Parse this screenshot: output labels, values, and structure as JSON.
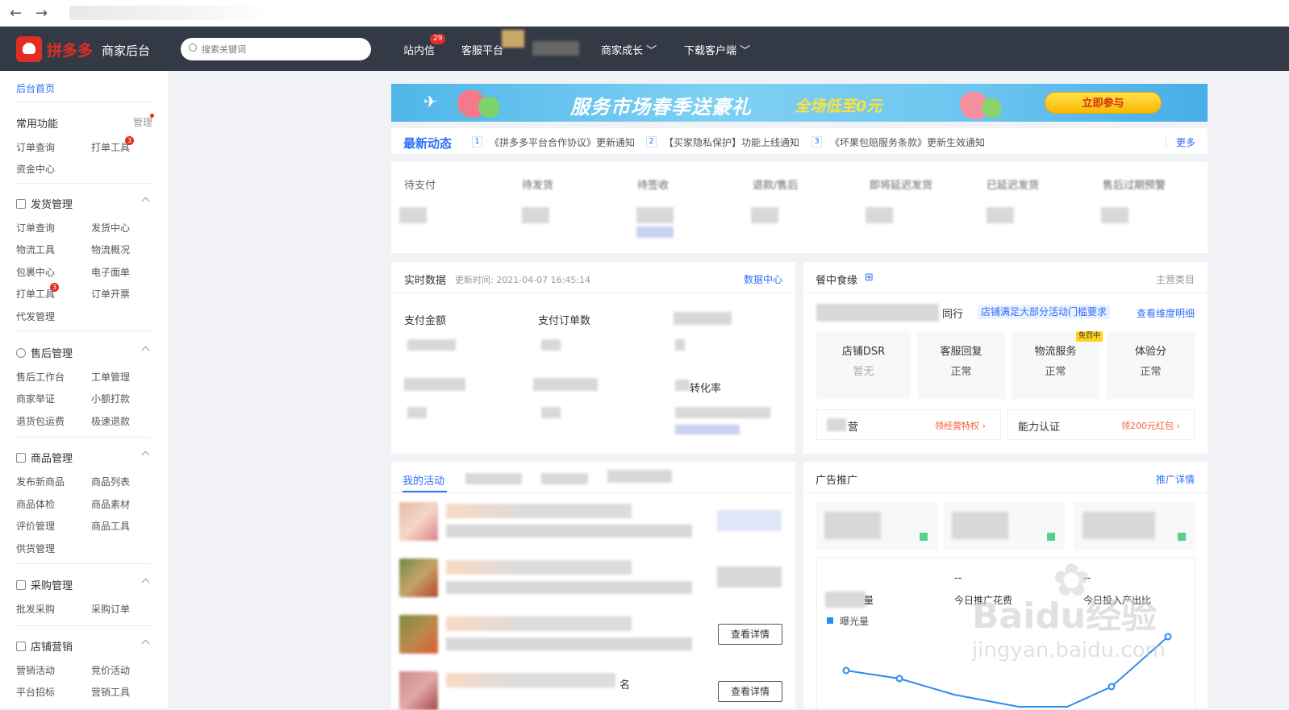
{
  "browser": {
    "back_icon": "arrow-left-icon",
    "forward_icon": "arrow-right-icon"
  },
  "header": {
    "brand": "拼多多",
    "subtitle": "商家后台",
    "search_placeholder": "搜索关键词",
    "nav": [
      {
        "label": "站内信",
        "badge": "29"
      },
      {
        "label": "客服平台"
      },
      {
        "label": "商家成长"
      },
      {
        "label": "下载客户端"
      }
    ]
  },
  "sidebar": {
    "home": "后台首页",
    "common": {
      "title": "常用功能",
      "manage": "管理",
      "items": [
        "订单查询",
        "打单工具",
        "资金中心"
      ],
      "badge": "3"
    },
    "sections": [
      {
        "title": "发货管理",
        "items": [
          "订单查询",
          "发货中心",
          "物流工具",
          "物流概况",
          "包裹中心",
          "电子面单",
          "打单工具",
          "订单开票",
          "代发管理"
        ],
        "badge": "3"
      },
      {
        "title": "售后管理",
        "items": [
          "售后工作台",
          "工单管理",
          "商家举证",
          "小额打款",
          "退货包运费",
          "极速退款"
        ]
      },
      {
        "title": "商品管理",
        "items": [
          "发布新商品",
          "商品列表",
          "商品体检",
          "商品素材",
          "评价管理",
          "商品工具",
          "供货管理"
        ]
      },
      {
        "title": "采购管理",
        "items": [
          "批发采购",
          "采购订单"
        ]
      },
      {
        "title": "店铺营销",
        "items": [
          "营销活动",
          "竞价活动",
          "平台招标",
          "营销工具"
        ]
      }
    ]
  },
  "banner": {
    "title": "服务市场春季送豪礼",
    "subtitle": "全场低至0元",
    "button": "立即参与"
  },
  "news": {
    "title": "最新动态",
    "items": [
      {
        "num": "1",
        "text": "《拼多多平台合作协议》更新通知"
      },
      {
        "num": "2",
        "text": "【买家隐私保护】功能上线通知"
      },
      {
        "num": "3",
        "text": "《坏果包赔服务条款》更新生效通知"
      }
    ],
    "more": "更多"
  },
  "orders": {
    "labels": [
      "待支付",
      "待发货",
      "待签收",
      "退款/售后",
      "即将延迟发货",
      "已延迟发货",
      "售后过期预警"
    ]
  },
  "realtime": {
    "title": "实时数据",
    "update_time": "更新时间: 2021-04-07 16:45:14",
    "link": "数据中心",
    "metrics": [
      "支付金额",
      "支付订单数",
      "转化率"
    ]
  },
  "shop": {
    "category": "餐中食缘",
    "main_category": "主营类目",
    "peer_label": "同行",
    "tag": "店铺满足大部分活动门槛要求",
    "detail_link": "查看维度明细",
    "dsr": [
      {
        "title": "店铺DSR",
        "value": "暂无"
      },
      {
        "title": "客服回复",
        "value": "正常"
      },
      {
        "title": "物流服务",
        "value": "正常",
        "tag": "免罚中"
      },
      {
        "title": "体验分",
        "value": "正常"
      }
    ],
    "entries": [
      {
        "label": "营",
        "action": "领经营特权 ›"
      },
      {
        "label": "能力认证",
        "action": "领200元红包 ›"
      }
    ]
  },
  "activities": {
    "tab_active": "我的活动",
    "buttons": [
      "查看详情",
      "查看详情"
    ],
    "trailing": "名"
  },
  "ads": {
    "title": "广告推广",
    "link": "推广详情",
    "metrics": [
      "量",
      "今日推广花费",
      "今日投入产出比"
    ],
    "dash": "--",
    "legend": "曝光量"
  },
  "watermark": {
    "brand": "Baidu经验",
    "url": "jingyan.baidu.com"
  }
}
